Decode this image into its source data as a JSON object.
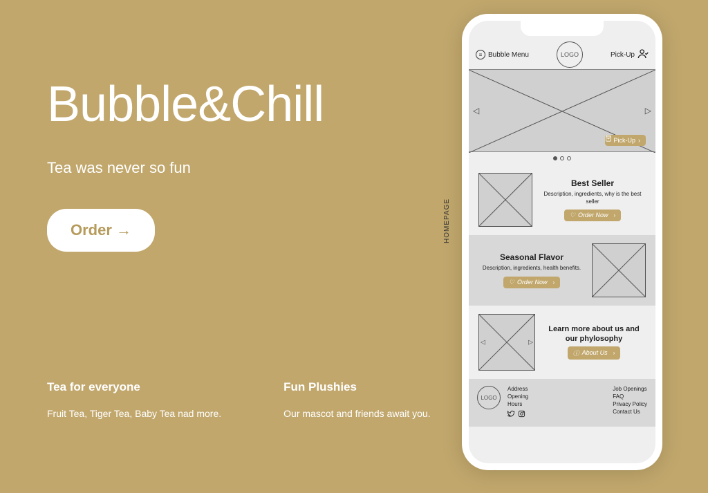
{
  "hero": {
    "title": "Bubble&Chill",
    "subtitle": "Tea was never so fun",
    "order_label": "Order →"
  },
  "features": [
    {
      "title": "Tea for everyone",
      "desc": "Fruit Tea, Tiger Tea, Baby Tea nad more."
    },
    {
      "title": "Fun Plushies",
      "desc": "Our mascot and friends await you."
    }
  ],
  "side_label": "HOMEPAGE",
  "phone": {
    "header": {
      "menu_label": "Bubble Menu",
      "logo_text": "LOGO",
      "pickup_label": "Pick-Up"
    },
    "hero_pickup_pill": "Pick-Up",
    "cards": {
      "best_seller": {
        "title": "Best Seller",
        "desc": "Description, ingredients, why is the best seller",
        "btn": "Order Now"
      },
      "seasonal": {
        "title": "Seasonal Flavor",
        "desc": "Description, ingredients, health benefits.",
        "btn": "Order Now"
      },
      "about": {
        "title": "Learn more about us and our phylosophy",
        "btn": "About Us"
      }
    },
    "footer": {
      "logo_text": "LOGO",
      "col1": [
        "Address",
        "Opening",
        "Hours"
      ],
      "col2": [
        "Job Openings",
        "FAQ",
        "Privacy Policy",
        "Contact Us"
      ]
    }
  },
  "colors": {
    "accent": "#c1a76c"
  }
}
